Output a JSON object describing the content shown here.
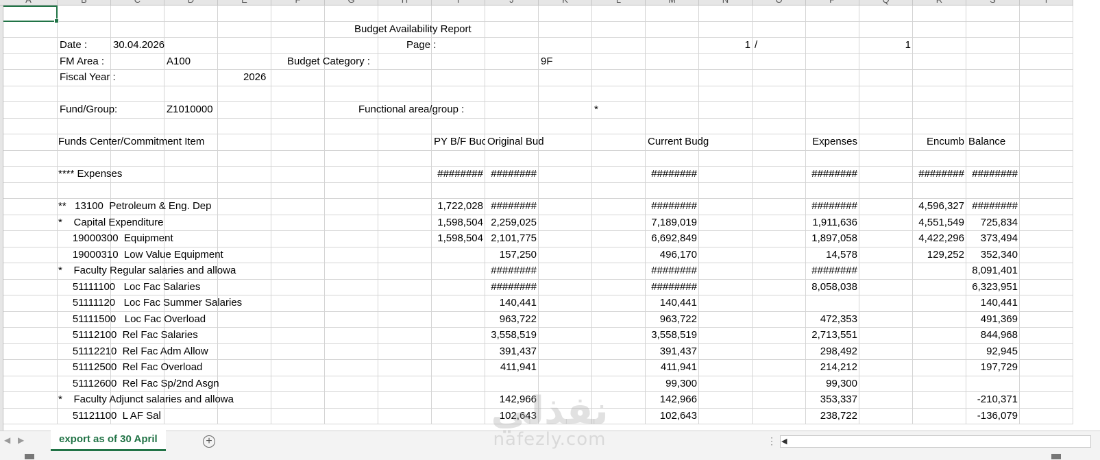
{
  "spreadsheet": {
    "columns": [
      "A",
      "B",
      "C",
      "D",
      "E",
      "F",
      "G",
      "H",
      "I",
      "J",
      "K",
      "L",
      "M",
      "N",
      "O",
      "P",
      "Q",
      "R",
      "S",
      "T"
    ]
  },
  "report": {
    "title": "Budget Availability Report",
    "date_label": "Date :",
    "date_value": "30.04.2026",
    "page_label": "Page :",
    "page_current": "1",
    "page_sep": "/",
    "page_total": "1",
    "fm_area_label": "FM Area :",
    "fm_area_value": "A100",
    "budget_category_label": "Budget Category :",
    "budget_category_value": "9F",
    "fiscal_year_label": "Fiscal Year :",
    "fiscal_year_value": "2026",
    "fund_label": "Fund/Group:",
    "fund_value": "Z1010000",
    "functional_area_label": "Functional area/group :",
    "functional_area_value": "*",
    "headers": {
      "funds_center": "Funds Center/Commitment Item",
      "py_bf": "PY B/F Buc",
      "original": "Original Bud",
      "current": "Current Budg",
      "expenses": "Expenses",
      "encumb": "Encumb",
      "balance": "Balance"
    },
    "rows": [
      {
        "label": "**** Expenses",
        "py": "########",
        "orig": "########",
        "curr": "########",
        "exp": "########",
        "enc": "########",
        "bal": "########"
      },
      {
        "label": "**   13100  Petroleum & Eng. Dep",
        "py": "1,722,028",
        "orig": "########",
        "curr": "########",
        "exp": "########",
        "enc": "4,596,327",
        "bal": "########"
      },
      {
        "label": "*    Capital Expenditure",
        "py": "1,598,504",
        "orig": "2,259,025",
        "curr": "7,189,019",
        "exp": "1,911,636",
        "enc": "4,551,549",
        "bal": "725,834"
      },
      {
        "label": "     19000300  Equipment",
        "py": "1,598,504",
        "orig": "2,101,775",
        "curr": "6,692,849",
        "exp": "1,897,058",
        "enc": "4,422,296",
        "bal": "373,494"
      },
      {
        "label": "     19000310  Low Value Equipment",
        "py": "",
        "orig": "157,250",
        "curr": "496,170",
        "exp": "14,578",
        "enc": "129,252",
        "bal": "352,340"
      },
      {
        "label": "*    Faculty Regular salaries and allowa",
        "py": "",
        "orig": "########",
        "curr": "########",
        "exp": "########",
        "enc": "",
        "bal": "8,091,401"
      },
      {
        "label": "     51111100   Loc Fac Salaries",
        "py": "",
        "orig": "########",
        "curr": "########",
        "exp": "8,058,038",
        "enc": "",
        "bal": "6,323,951"
      },
      {
        "label": "     51111120   Loc Fac Summer Salaries",
        "py": "",
        "orig": "140,441",
        "curr": "140,441",
        "exp": "",
        "enc": "",
        "bal": "140,441"
      },
      {
        "label": "     51111500   Loc Fac Overload",
        "py": "",
        "orig": "963,722",
        "curr": "963,722",
        "exp": "472,353",
        "enc": "",
        "bal": "491,369"
      },
      {
        "label": "     51112100  Rel Fac Salaries",
        "py": "",
        "orig": "3,558,519",
        "curr": "3,558,519",
        "exp": "2,713,551",
        "enc": "",
        "bal": "844,968"
      },
      {
        "label": "     51112210  Rel Fac Adm Allow",
        "py": "",
        "orig": "391,437",
        "curr": "391,437",
        "exp": "298,492",
        "enc": "",
        "bal": "92,945"
      },
      {
        "label": "     51112500  Rel Fac Overload",
        "py": "",
        "orig": "411,941",
        "curr": "411,941",
        "exp": "214,212",
        "enc": "",
        "bal": "197,729"
      },
      {
        "label": "     51112600  Rel Fac Sp/2nd Asgn",
        "py": "",
        "orig": "",
        "curr": "99,300",
        "exp": "99,300",
        "enc": "",
        "bal": ""
      },
      {
        "label": "*    Faculty Adjunct salaries and allowa",
        "py": "",
        "orig": "142,966",
        "curr": "142,966",
        "exp": "353,337",
        "enc": "",
        "bal": "-210,371"
      },
      {
        "label": "     51121100  L AF Sal",
        "py": "",
        "orig": "102,643",
        "curr": "102,643",
        "exp": "238,722",
        "enc": "",
        "bal": "-136,079"
      }
    ]
  },
  "sheet_tabs": {
    "active": "export as of 30 April",
    "add_symbol": "+"
  },
  "watermark": {
    "arabic": "نفذلي",
    "latin": "nafezly.com"
  },
  "colors": {
    "accent": "#217346",
    "gridline": "#d4d4d4",
    "header_bg": "#e6e6e6"
  }
}
